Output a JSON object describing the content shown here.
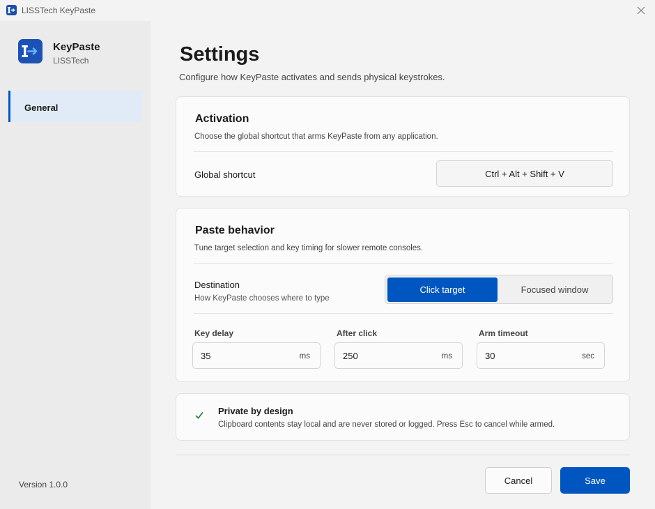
{
  "window": {
    "title": "LISSTech KeyPaste"
  },
  "sidebar": {
    "app_name": "KeyPaste",
    "vendor": "LISSTech",
    "nav": [
      {
        "label": "General",
        "selected": true
      }
    ],
    "version": "Version 1.0.0"
  },
  "page": {
    "title": "Settings",
    "subtitle": "Configure how KeyPaste activates and sends physical keystrokes."
  },
  "activation": {
    "title": "Activation",
    "description": "Choose the global shortcut that arms KeyPaste from any application.",
    "shortcut_label": "Global shortcut",
    "shortcut_value": "Ctrl + Alt + Shift + V"
  },
  "paste_behavior": {
    "title": "Paste behavior",
    "description": "Tune target selection and key timing for slower remote consoles.",
    "destination_label": "Destination",
    "destination_hint": "How KeyPaste chooses where to type",
    "destination_options": [
      "Click target",
      "Focused window"
    ],
    "destination_selected": "Click target",
    "key_delay": {
      "label": "Key delay",
      "value": "35",
      "unit": "ms"
    },
    "after_click": {
      "label": "After click",
      "value": "250",
      "unit": "ms"
    },
    "arm_timeout": {
      "label": "Arm timeout",
      "value": "30",
      "unit": "sec"
    }
  },
  "privacy": {
    "title": "Private by design",
    "text": "Clipboard contents stay local and are never stored or logged. Press Esc to cancel while armed."
  },
  "footer": {
    "cancel_label": "Cancel",
    "save_label": "Save"
  },
  "icons": {
    "app_icon": "cursor-arrow-icon",
    "close": "close-icon",
    "check": "checkmark-icon"
  },
  "colors": {
    "accent": "#0056c0",
    "check": "#1e7d32",
    "nav_selected_bg": "#e1ebf7"
  }
}
